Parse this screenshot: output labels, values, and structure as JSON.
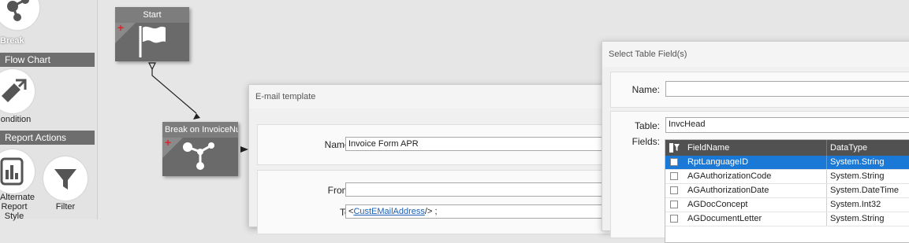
{
  "palette": {
    "break_label": "Break",
    "flow_chart_header": "Flow Chart",
    "condition_label": "ondition",
    "report_actions_header": "Report Actions",
    "alternate_label_lines": [
      "Alternate",
      "Report",
      "Style"
    ],
    "filter_label": "Filter"
  },
  "canvas": {
    "start_node_title": "Start",
    "break_node_title": "Break on InvoiceNu"
  },
  "email_dialog": {
    "title": "E-mail template",
    "name_label": "Name:",
    "name_value": "Invoice Form APR",
    "from_label": "From:",
    "from_value": "",
    "to_label": "To:",
    "to_prefix": "<",
    "to_link": "CustEMailAddress",
    "to_suffix": "/> ;"
  },
  "fields_dialog": {
    "title": "Select Table Field(s)",
    "name_label": "Name:",
    "name_value": "",
    "table_label": "Table:",
    "table_value": "InvcHead",
    "fields_label": "Fields:",
    "columns": [
      "FieldName",
      "DataType"
    ],
    "rows": [
      {
        "field": "RptLanguageID",
        "type": "System.String",
        "selected": true
      },
      {
        "field": "AGAuthorizationCode",
        "type": "System.String",
        "selected": false
      },
      {
        "field": "AGAuthorizationDate",
        "type": "System.DateTime",
        "selected": false
      },
      {
        "field": "AGDocConcept",
        "type": "System.Int32",
        "selected": false
      },
      {
        "field": "AGDocumentLetter",
        "type": "System.String",
        "selected": false
      }
    ]
  },
  "colors": {
    "selection": "#1a79d6",
    "grid_header": "#515151",
    "section_header": "#6e6e6e",
    "node": "#6a6a6a",
    "plus": "#e0232a"
  }
}
